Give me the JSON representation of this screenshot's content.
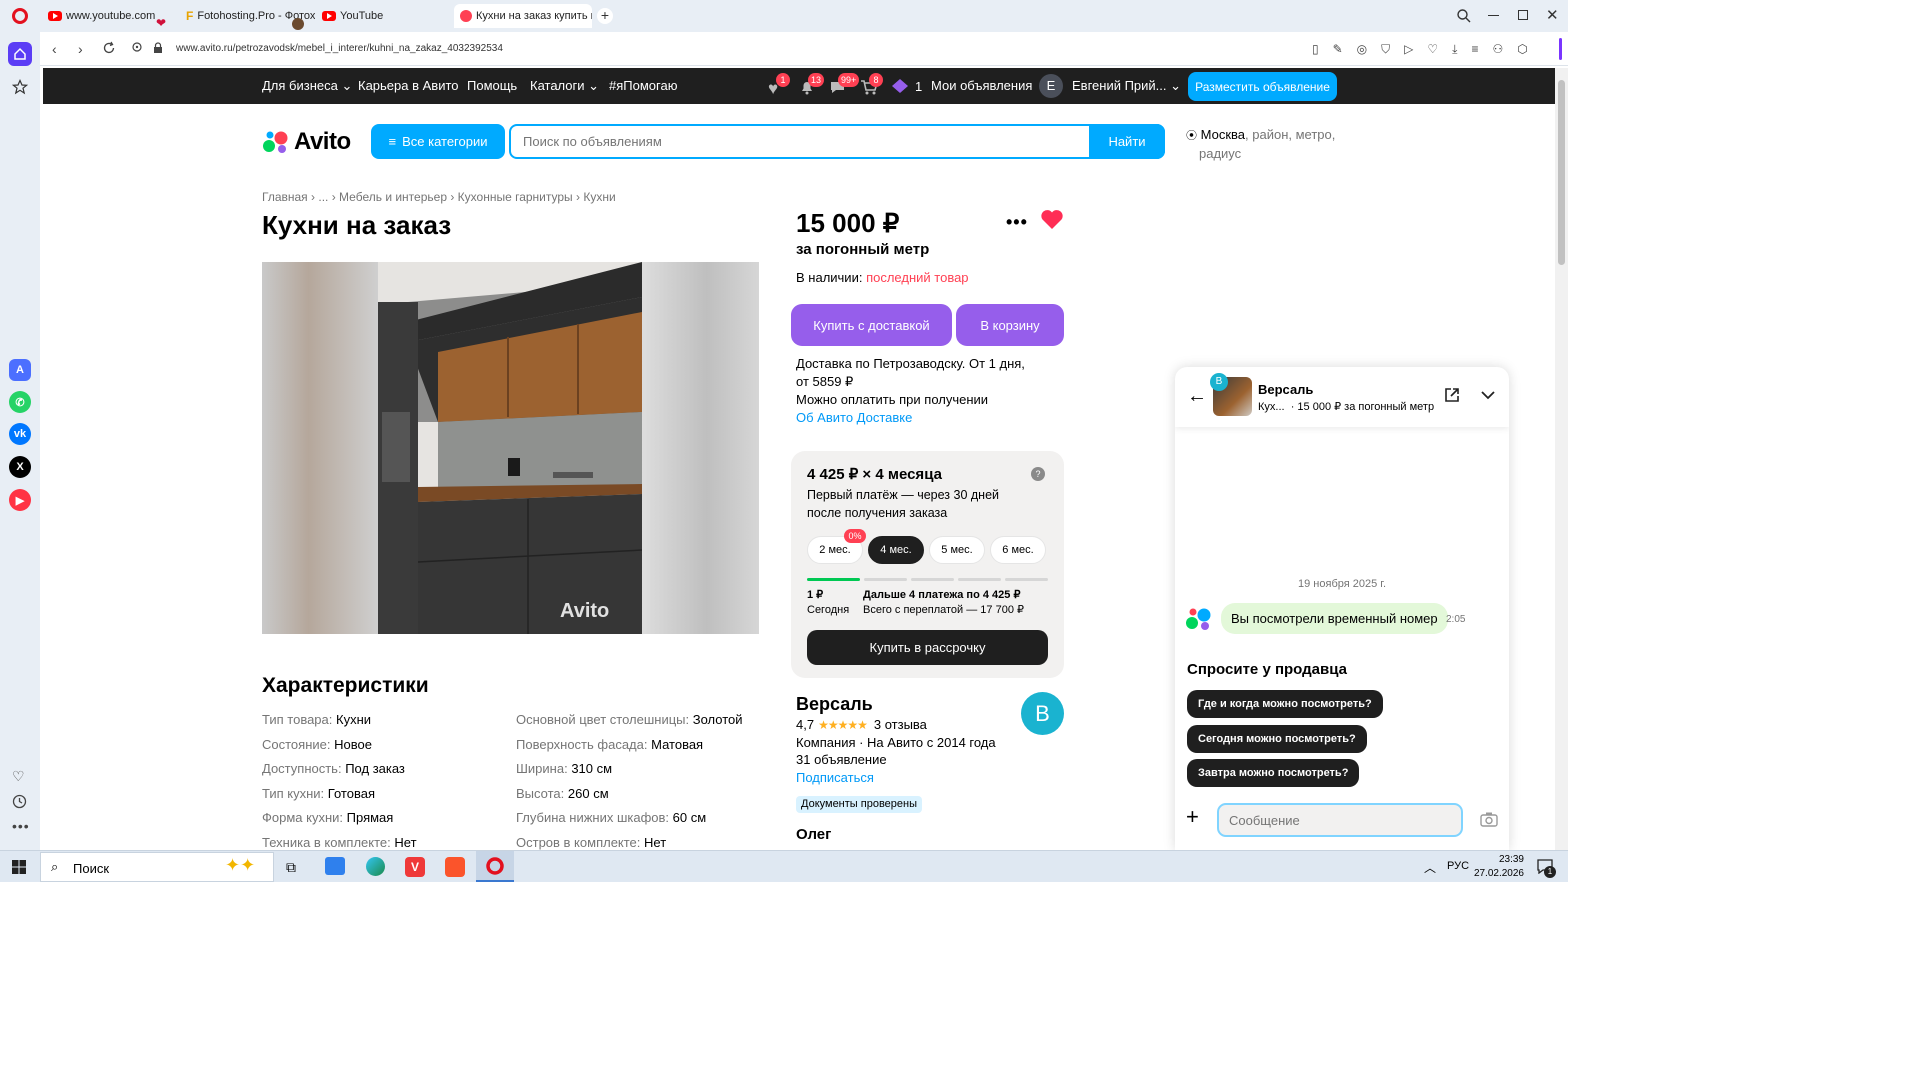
{
  "browser": {
    "tabs": [
      {
        "label": "www.youtube.com"
      },
      {
        "label": "Fotohosting.Pro - Фотохо"
      },
      {
        "label": "YouTube"
      },
      {
        "label": "Кухни на заказ купить в Пе"
      }
    ],
    "url": "www.avito.ru/petrozavodsk/mebel_i_interer/kuhni_na_zakaz_4032392534"
  },
  "topnav": {
    "business": "Для бизнеса",
    "career": "Карьера в Авито",
    "help": "Помощь",
    "catalogs": "Каталоги",
    "hashtag": "#яПомогаю",
    "badges": {
      "favorites": "1",
      "notifications": "13",
      "messages": "99+",
      "cart": "8"
    },
    "bonus_count": "1",
    "my_ads": "Мои объявления",
    "avatar_letter": "Е",
    "user_name": "Евгений Прий...",
    "post_ad": "Разместить объявление"
  },
  "search": {
    "logo": "Avito",
    "all_categories": "Все категории",
    "placeholder": "Поиск по объявлениям",
    "find": "Найти",
    "location_city": "Москва",
    "location_rest": ", район, метро,",
    "location_rest2": "радиус"
  },
  "breadcrumb": [
    "Главная",
    "...",
    "Мебель и интерьер",
    "Кухонные гарнитуры",
    "Кухни"
  ],
  "listing": {
    "title": "Кухни на заказ",
    "watermark": "Avito",
    "price": "15 000 ₽",
    "price_unit": "за погонный метр",
    "availability_label": "В наличии:",
    "availability_value": "последний товар",
    "buy_delivery": "Купить с доставкой",
    "to_cart": "В корзину",
    "delivery_line1": "Доставка по Петрозаводску. От 1 дня,",
    "delivery_line2": "от 5859 ₽",
    "pay_on_receipt": "Можно оплатить при получении",
    "about_delivery": "Об Авито Доставке"
  },
  "installment": {
    "title": "4 425 ₽ × 4 месяца",
    "help": "?",
    "desc_line1": "Первый платёж — через 30 дней",
    "desc_line2": "после получения заказа",
    "options": [
      "2 мес.",
      "4 мес.",
      "5 мес.",
      "6 мес."
    ],
    "selected": "4 мес.",
    "promo_badge": "0%",
    "first_amount": "1 ₽",
    "first_when": "Сегодня",
    "next_payments": "Дальше 4 платежа по 4 425 ₽",
    "total": "Всего с переплатой — 17 700 ₽",
    "buy_installment": "Купить в рассрочку"
  },
  "seller": {
    "name": "Версаль",
    "rating": "4,7",
    "stars": 4.7,
    "reviews": "3 отзыва",
    "info": "Компания · На Авито с 2014 года",
    "ads_count": "31 объявление",
    "subscribe": "Подписаться",
    "avatar_letter": "В",
    "verified": "Документы проверены",
    "contact_name": "Олег"
  },
  "characteristics": {
    "heading": "Характеристики",
    "left": [
      {
        "k": "Тип товара:",
        "v": "Кухни"
      },
      {
        "k": "Состояние:",
        "v": "Новое"
      },
      {
        "k": "Доступность:",
        "v": "Под заказ"
      },
      {
        "k": "Тип кухни:",
        "v": "Готовая"
      },
      {
        "k": "Форма кухни:",
        "v": "Прямая"
      },
      {
        "k": "Техника в комплекте:",
        "v": "Нет"
      }
    ],
    "right": [
      {
        "k": "Основной цвет столешницы:",
        "v": "Золотой"
      },
      {
        "k": "Поверхность фасада:",
        "v": "Матовая"
      },
      {
        "k": "Ширина:",
        "v": "310 см"
      },
      {
        "k": "Высота:",
        "v": "260 см"
      },
      {
        "k": "Глубина нижних шкафов:",
        "v": "60 см"
      },
      {
        "k": "Остров в комплекте:",
        "v": "Нет"
      }
    ]
  },
  "chat": {
    "seller_name": "Версаль",
    "item_short": "Кух...",
    "item_price": "· 15 000 ₽ за погонный метр",
    "avatar_letter": "В",
    "date": "19 ноября 2025 г.",
    "message": "Вы посмотрели временный номер",
    "message_time": "2:05",
    "ask_heading": "Спросите у продавца",
    "quick_questions": [
      "Где и когда можно посмотреть?",
      "Сегодня можно посмотреть?",
      "Завтра можно посмотреть?"
    ],
    "input_placeholder": "Сообщение"
  },
  "taskbar": {
    "search_label": "Поиск",
    "lang": "РУС",
    "time": "23:39",
    "date": "27.02.2026",
    "notif_count": "1"
  },
  "colors": {
    "accent_blue": "#00aaff",
    "purple": "#965eeb",
    "red": "#ff4053",
    "dark": "#1f1f1f",
    "link": "#0099f7"
  }
}
